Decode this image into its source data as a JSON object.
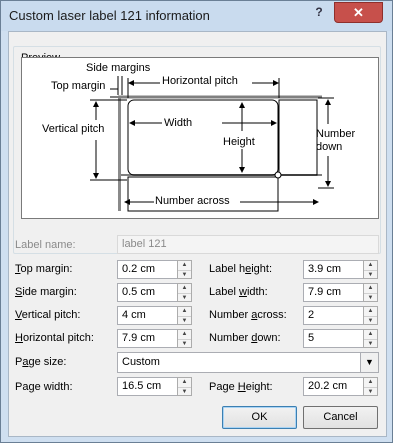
{
  "window": {
    "title": "Custom laser label 121 information",
    "help_glyph": "?",
    "close_glyph": "✕"
  },
  "preview": {
    "legend": "Preview",
    "labels": {
      "side_margins": "Side margins",
      "top_margin": "Top margin",
      "horizontal_pitch": "Horizontal pitch",
      "vertical_pitch": "Vertical pitch",
      "width": "Width",
      "height": "Height",
      "number_down_1": "Number",
      "number_down_2": "down",
      "number_across": "Number across"
    }
  },
  "label_name": {
    "label": "Label name:",
    "value": "label 121"
  },
  "left_fields": [
    {
      "pre": "",
      "key": "T",
      "post": "op margin:",
      "value": "0.2 cm"
    },
    {
      "pre": "",
      "key": "S",
      "post": "ide margin:",
      "value": "0.5 cm"
    },
    {
      "pre": "",
      "key": "V",
      "post": "ertical pitch:",
      "value": "4 cm"
    },
    {
      "pre": "",
      "key": "H",
      "post": "orizontal pitch:",
      "value": "7.9 cm"
    }
  ],
  "right_fields": [
    {
      "pre": "Label h",
      "key": "e",
      "post": "ight:",
      "value": "3.9 cm"
    },
    {
      "pre": "Label ",
      "key": "w",
      "post": "idth:",
      "value": "7.9 cm"
    },
    {
      "pre": "Number ",
      "key": "a",
      "post": "cross:",
      "value": "2"
    },
    {
      "pre": "Number ",
      "key": "d",
      "post": "own:",
      "value": "5"
    }
  ],
  "page_size": {
    "pre": "P",
    "key": "a",
    "post": "ge size:",
    "value": "Custom"
  },
  "page_width": {
    "pre": "Pa",
    "key": "g",
    "post": "e width:",
    "value": "16.5 cm"
  },
  "page_height": {
    "pre": "Page ",
    "key": "H",
    "post": "eight:",
    "value": "20.2 cm"
  },
  "buttons": {
    "ok": "OK",
    "cancel": "Cancel"
  }
}
